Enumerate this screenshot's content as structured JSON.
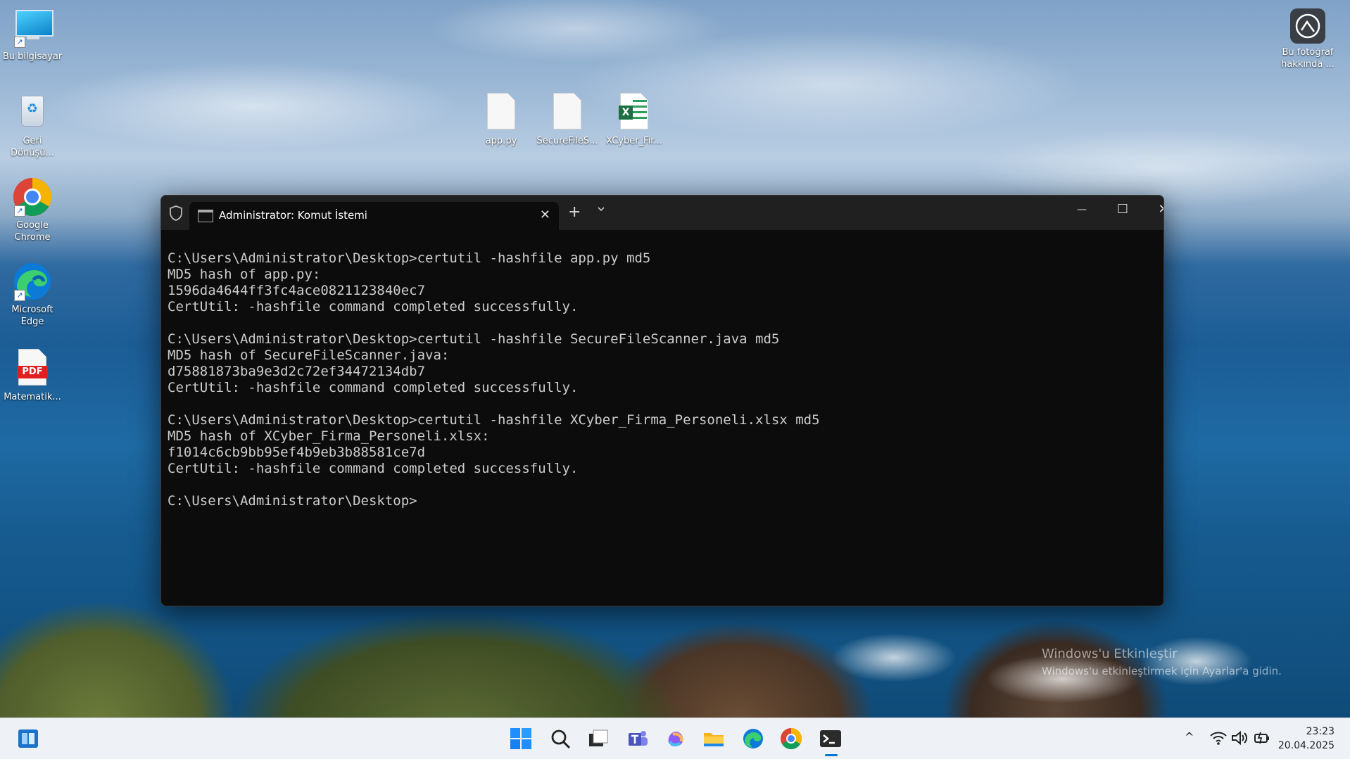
{
  "desktop": {
    "icons_left": [
      {
        "label": "Bu bilgisayar"
      },
      {
        "label": "Geri\nDönüşü..."
      },
      {
        "label": "Google\nChrome"
      },
      {
        "label": "Microsoft\nEdge"
      },
      {
        "label": "Matematik..."
      }
    ],
    "icons_files": [
      {
        "label": "app.py"
      },
      {
        "label": "SecureFileS..."
      },
      {
        "label": "XCyber_Fir..."
      }
    ],
    "about_photo": {
      "label": "Bu fotoğraf\nhakkında ..."
    },
    "pdf_badge": "PDF",
    "excel_badge": "X"
  },
  "terminal": {
    "tab_title": "Administrator: Komut İstemi",
    "close_tab_glyph": "✕",
    "new_tab_glyph": "+",
    "minimize_glyph": "—",
    "maximize_glyph": "☐",
    "close_glyph": "✕",
    "lines": [
      "C:\\Users\\Administrator\\Desktop>certutil -hashfile app.py md5",
      "MD5 hash of app.py:",
      "1596da4644ff3fc4ace0821123840ec7",
      "CertUtil: -hashfile command completed successfully.",
      "",
      "C:\\Users\\Administrator\\Desktop>certutil -hashfile SecureFileScanner.java md5",
      "MD5 hash of SecureFileScanner.java:",
      "d75881873ba9e3d2c72ef34472134db7",
      "CertUtil: -hashfile command completed successfully.",
      "",
      "C:\\Users\\Administrator\\Desktop>certutil -hashfile XCyber_Firma_Personeli.xlsx md5",
      "MD5 hash of XCyber_Firma_Personeli.xlsx:",
      "f1014c6cb9bb95ef4b9eb3b88581ce7d",
      "CertUtil: -hashfile command completed successfully.",
      "",
      "C:\\Users\\Administrator\\Desktop>"
    ]
  },
  "watermark": {
    "line1": "Windows'u Etkinleştir",
    "line2": "Windows'u etkinleştirmek için Ayarlar'a gidin."
  },
  "taskbar": {
    "apps": [
      "start-icon",
      "search-icon",
      "task-view-icon",
      "teams-icon",
      "copilot-icon",
      "file-explorer-icon",
      "edge-icon",
      "chrome-icon",
      "terminal-icon"
    ],
    "time": "23:23",
    "date": "20.04.2025",
    "tray_chevron": "^"
  },
  "colors": {
    "terminal_bg": "#0c0c0c",
    "titlebar_bg": "#202020",
    "console_text": "#cccccc",
    "taskbar_bg": "#eef1f5",
    "accent": "#0078d4"
  }
}
